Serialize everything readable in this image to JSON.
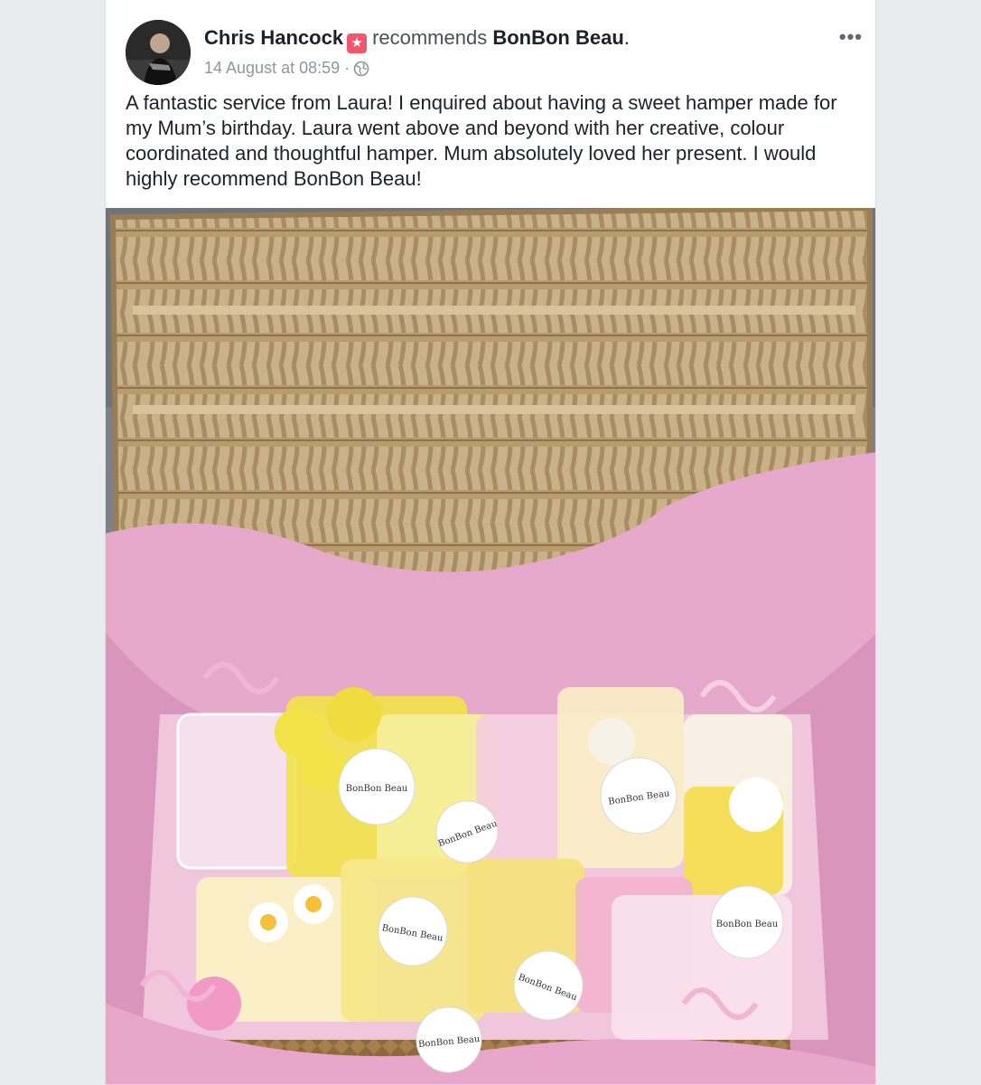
{
  "post": {
    "author": "Chris Hancock",
    "recommend_icon": "recommendation-star-icon",
    "verb": "recommends",
    "page_name": "BonBon Beau",
    "punctuation": ".",
    "timestamp": "14 August at 08:59",
    "separator": "·",
    "privacy_icon": "globe-icon",
    "more_label": "•••",
    "text": "A fantastic service from Laura! I enquired about having a sweet hamper made for my Mum’s birthday. Laura went above and beyond with her creative, colour coordinated and thoughtful hamper. Mum absolutely loved her present. I would highly recommend BonBon Beau!"
  },
  "photo": {
    "labels": [
      "BonBon Beau",
      "BonBon Beau",
      "BonBon Beau",
      "BonBon Beau",
      "BonBon Beau",
      "BonBon Beau",
      "BonBon Beau"
    ]
  },
  "colors": {
    "recommend_badge": "#f2566c",
    "tissue_pink": "#e3a2c6",
    "wicker": "#c7ad83"
  }
}
